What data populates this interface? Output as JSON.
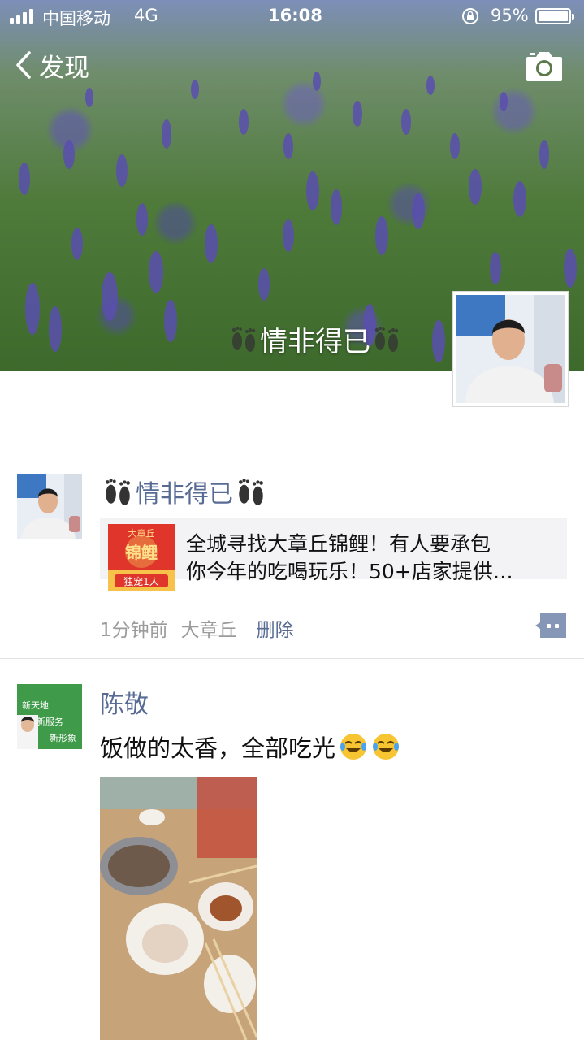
{
  "status_bar": {
    "carrier": "中国移动",
    "network": "4G",
    "time": "16:08",
    "battery": "95%"
  },
  "nav": {
    "back_label": "发现"
  },
  "profile": {
    "name": "情非得已"
  },
  "posts": [
    {
      "author": "情非得已",
      "link_card": {
        "line1": "全城寻找大章丘锦鲤！有人要承包",
        "line2": "你今年的吃喝玩乐！50+店家提供…",
        "thumb_top": "大章丘",
        "thumb_main": "锦鲤",
        "thumb_bottom": "独宠1人"
      },
      "time": "1分钟前",
      "location": "大章丘",
      "delete_label": "删除"
    },
    {
      "author": "陈敬",
      "avatar_text": [
        "新天地",
        "新服务",
        "新形象"
      ],
      "text": "饭做的太香，全部吃光"
    }
  ],
  "colors": {
    "link_blue": "#576b95",
    "meta_gray": "#9b9b9b",
    "card_bg": "#f3f3f5"
  },
  "icons": [
    "signal-icon",
    "lock-rotation-icon",
    "battery-icon",
    "chevron-left-icon",
    "camera-icon",
    "feet-icon",
    "comment-icon",
    "crying-laughing-emoji-icon"
  ]
}
